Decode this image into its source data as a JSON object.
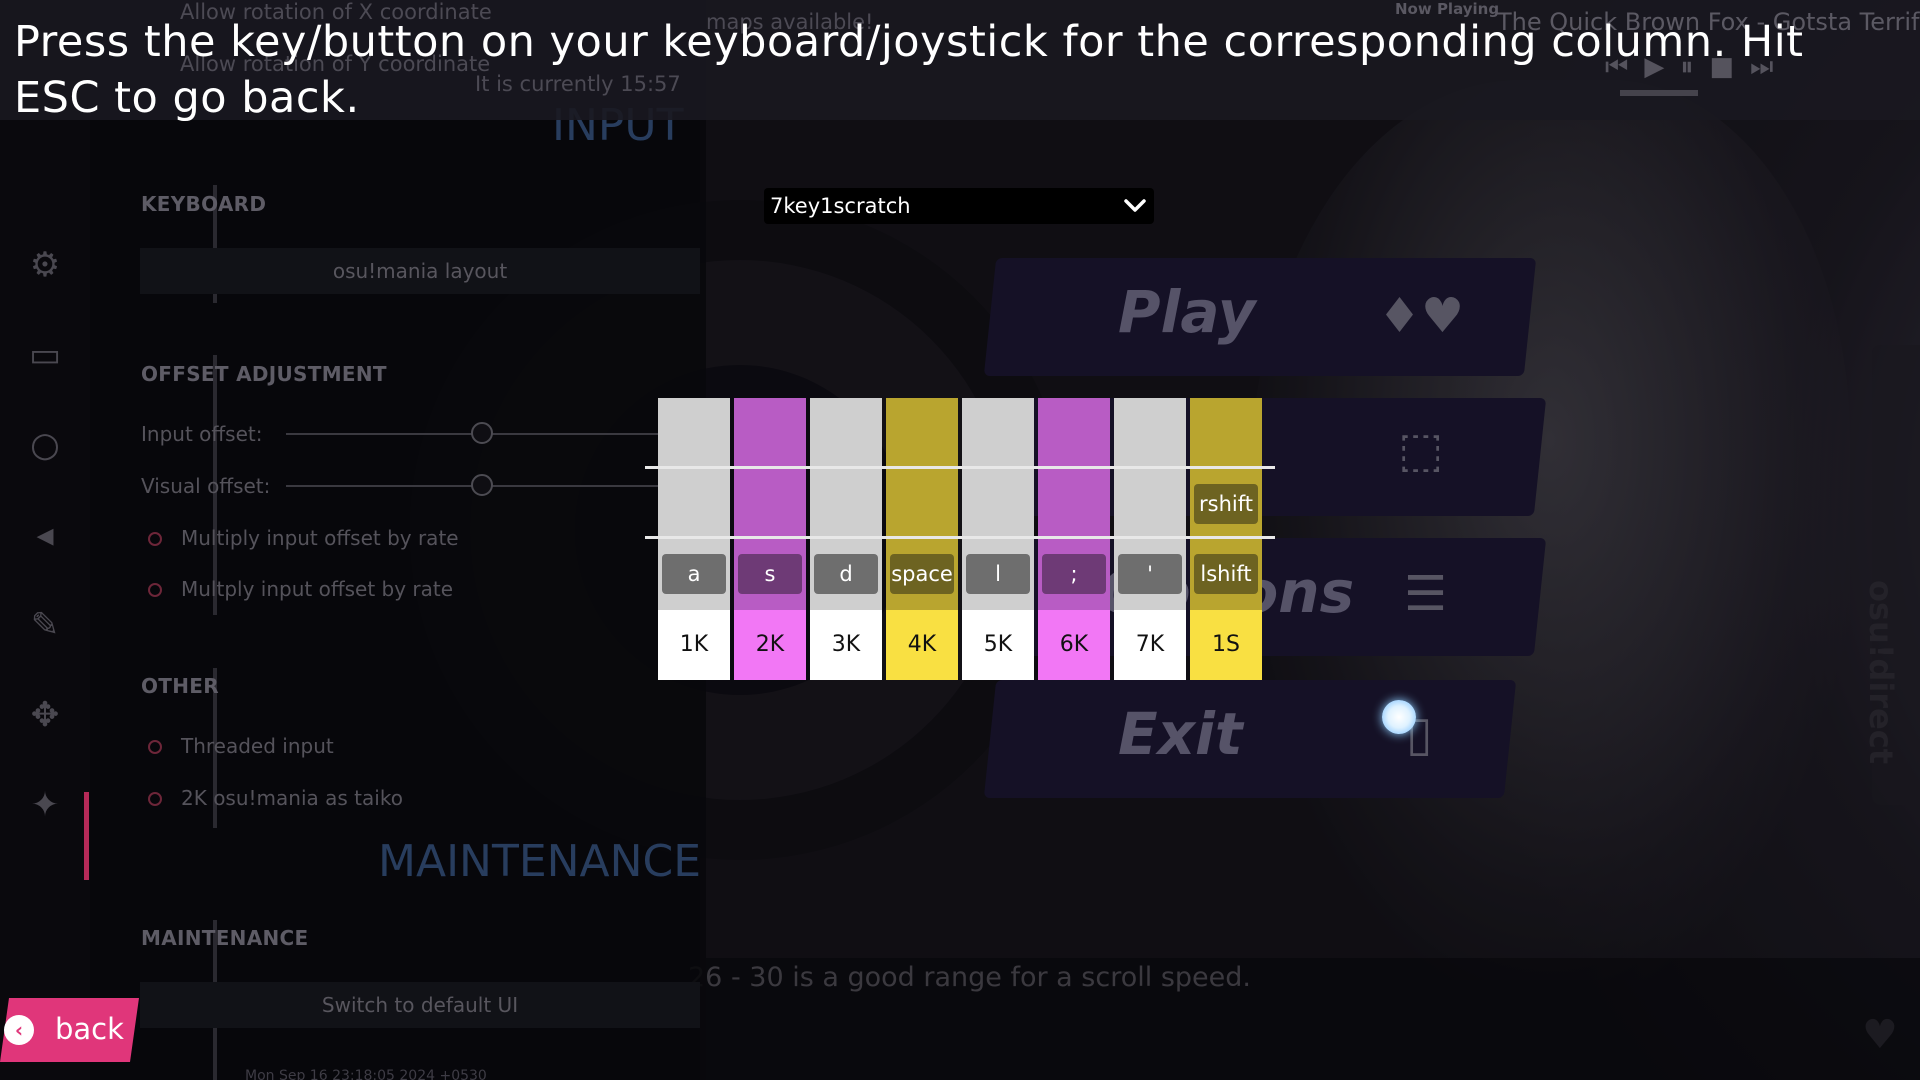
{
  "prompt": "Press the key/button on your keyboard/joystick for the corresponding column. Hit ESC to go back.",
  "top_bar": {
    "ghost_1": "Allow rotation of X coordinate",
    "ghost_2": "Allow rotation of Y coordinate",
    "ghost_3": "maps available!",
    "ghost_4": "It is currently 15:57",
    "now_playing_label": "Now Playing",
    "track": "The Quick Brown Fox - Gotsta Terrify"
  },
  "sidebar": {
    "icons": [
      "gear-icon",
      "monitor-icon",
      "circle-icon",
      "speaker-icon",
      "brush-icon",
      "gamepad-icon",
      "wrench-icon"
    ]
  },
  "options": {
    "input_heading": "INPUT",
    "keyboard_section": "KEYBOARD",
    "mania_layout_button": "osu!mania layout",
    "offset_section": "OFFSET ADJUSTMENT",
    "input_offset_label": "Input offset:",
    "visual_offset_label": "Visual offset:",
    "multiply_input_offset": "Multiply input offset by rate",
    "multply_input_offset": "Multply input offset by rate",
    "other_section": "OTHER",
    "threaded_input": "Threaded input",
    "taiko_option": "2K osu!mania as taiko",
    "maintenance_heading": "MAINTENANCE",
    "maintenance_section": "MAINTENANCE",
    "default_ui_button": "Switch to default UI",
    "fine_1": "Mon Sep 16 23:18:05 2024 +0530"
  },
  "main_menu": {
    "play": "Play",
    "options": "Options",
    "exit": "Exit"
  },
  "osu_direct": "osu!direct",
  "tip": "26 - 30 is a good range for a scroll speed.",
  "layout_dropdown": {
    "selected": "7key1scratch"
  },
  "columns": [
    {
      "label": "1K",
      "key": "a",
      "secondary": "",
      "color": "#cfcfcf",
      "chip": "#6e6e6e",
      "label_bg": "#ffffff"
    },
    {
      "label": "2K",
      "key": "s",
      "secondary": "",
      "color": "#b85cc4",
      "chip": "#6e3a76",
      "label_bg": "#f277f5"
    },
    {
      "label": "3K",
      "key": "d",
      "secondary": "",
      "color": "#cfcfcf",
      "chip": "#6e6e6e",
      "label_bg": "#ffffff"
    },
    {
      "label": "4K",
      "key": "space",
      "secondary": "",
      "color": "#b9a52f",
      "chip": "#6d6321",
      "label_bg": "#f9e042"
    },
    {
      "label": "5K",
      "key": "l",
      "secondary": "",
      "color": "#cfcfcf",
      "chip": "#6e6e6e",
      "label_bg": "#ffffff"
    },
    {
      "label": "6K",
      "key": ";",
      "secondary": "",
      "color": "#b85cc4",
      "chip": "#6e3a76",
      "label_bg": "#f277f5"
    },
    {
      "label": "7K",
      "key": "'",
      "secondary": "",
      "color": "#cfcfcf",
      "chip": "#6e6e6e",
      "label_bg": "#ffffff"
    },
    {
      "label": "1S",
      "key": "lshift",
      "secondary": "rshift",
      "color": "#b9a52f",
      "chip": "#6d6321",
      "label_bg": "#f9e042"
    }
  ],
  "back_button": {
    "label": "back"
  }
}
